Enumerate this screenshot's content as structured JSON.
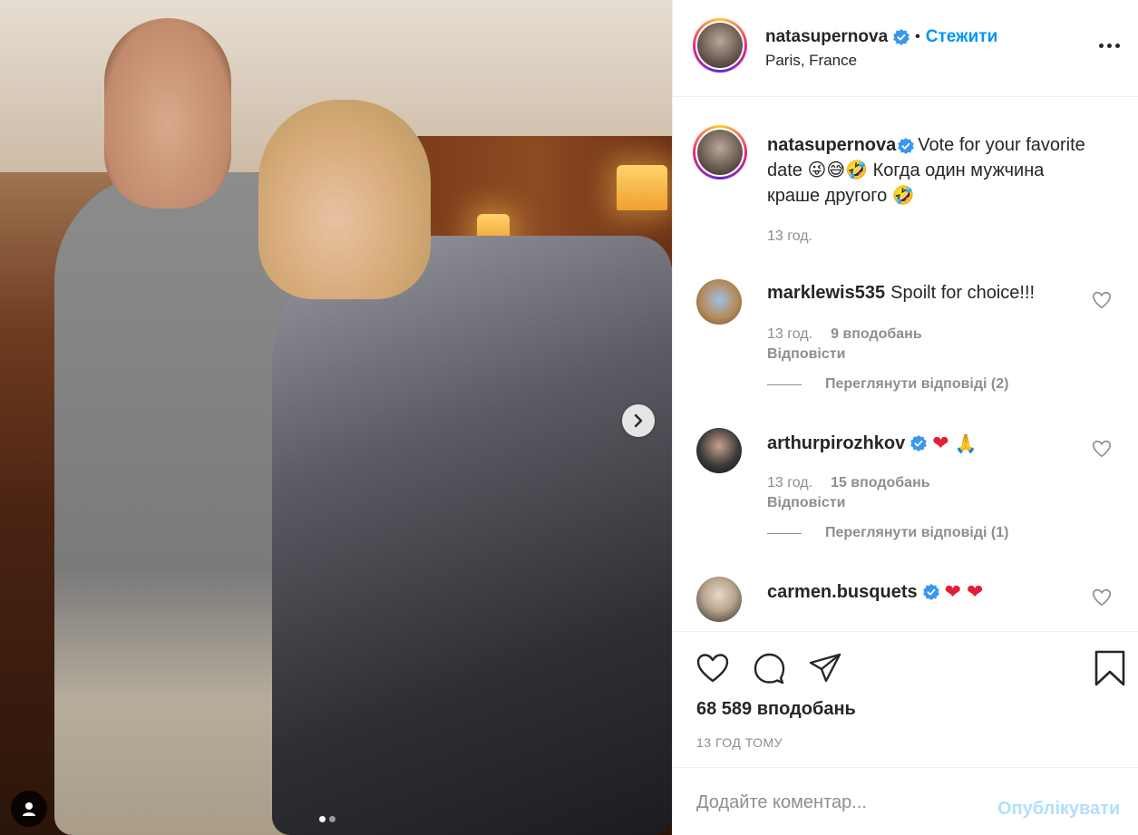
{
  "post": {
    "username": "natasupernova",
    "follow_label": "Стежити",
    "location": "Paris, France",
    "dot": "•"
  },
  "caption": {
    "username": "natasupernova",
    "text": "Vote for your favorite date 😜😅🤣 Когда один мужчина краше другого 🤣",
    "time": "13 год."
  },
  "comments": [
    {
      "user": "marklewis535",
      "text": "Spoilt for choice!!!",
      "time": "13 год.",
      "likes": "9 вподобань",
      "reply": "Відповісти",
      "view_replies": "Переглянути відповіді (2)"
    },
    {
      "user": "arthurpirozhkov",
      "text": "",
      "emoji": "🙏",
      "time": "13 год.",
      "likes": "15 вподобань",
      "reply": "Відповісти",
      "view_replies": "Переглянути відповіді (1)"
    },
    {
      "user": "carmen.busquets",
      "text": ""
    }
  ],
  "actions": {
    "likes": "68 589 вподобань",
    "ago": "13 ГОД ТОМУ"
  },
  "composer": {
    "placeholder": "Додайте коментар...",
    "publish": "Опублікувати"
  },
  "colors": {
    "accent": "#0095f6",
    "publish_disabled": "#b2dffc",
    "secondary_text": "#8e8e8e",
    "heart_red": "#e0203a"
  },
  "icons": {
    "verified": "verified-badge-icon",
    "more": "more-options-icon",
    "next": "chevron-right-icon",
    "tag": "user-tag-icon",
    "like": "heart-icon",
    "comment": "comment-icon",
    "share": "share-icon",
    "save": "bookmark-icon"
  },
  "carousel": {
    "slides": 2,
    "active": 1
  }
}
